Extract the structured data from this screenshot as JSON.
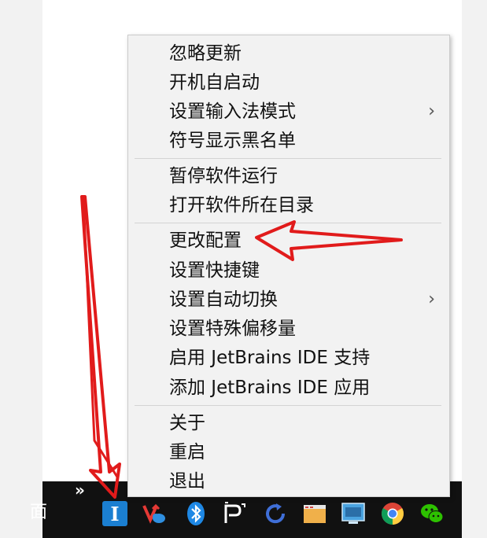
{
  "menu": {
    "groups": [
      {
        "items": [
          {
            "label": "忽略更新",
            "submenu": false
          },
          {
            "label": "开机自启动",
            "submenu": false
          },
          {
            "label": "设置输入法模式",
            "submenu": true
          },
          {
            "label": "符号显示黑名单",
            "submenu": false
          }
        ]
      },
      {
        "items": [
          {
            "label": "暂停软件运行",
            "submenu": false
          },
          {
            "label": "打开软件所在目录",
            "submenu": false
          }
        ]
      },
      {
        "items": [
          {
            "label": "更改配置",
            "submenu": false
          },
          {
            "label": "设置快捷键",
            "submenu": false
          },
          {
            "label": "设置自动切换",
            "submenu": true
          },
          {
            "label": "设置特殊偏移量",
            "submenu": false
          },
          {
            "label": "启用 JetBrains IDE 支持",
            "submenu": false
          },
          {
            "label": "添加 JetBrains IDE 应用",
            "submenu": false
          }
        ]
      },
      {
        "items": [
          {
            "label": "关于",
            "submenu": false
          },
          {
            "label": "重启",
            "submenu": false
          },
          {
            "label": "退出",
            "submenu": false
          }
        ]
      }
    ],
    "submenu_glyph": "›"
  },
  "taskbar": {
    "desktop_label": "面",
    "overflow_glyph": "»",
    "tray_icons": [
      {
        "name": "ime-icon",
        "glyph": "I",
        "color": "#1b7fd1"
      },
      {
        "name": "vlc-cloud-icon",
        "color": "#e53935"
      },
      {
        "name": "bluetooth-icon",
        "color": "#1e88e5"
      },
      {
        "name": "p-app-icon",
        "glyph": "P"
      },
      {
        "name": "refresh-icon",
        "color": "#3f6fd8"
      },
      {
        "name": "folder-icon",
        "color": "#f0b04a"
      },
      {
        "name": "monitor-icon",
        "color": "#4aa3df"
      },
      {
        "name": "chrome-icon"
      },
      {
        "name": "wechat-icon",
        "color": "#2dc100"
      }
    ]
  },
  "annotation": {
    "arrow_color": "#e11b1b"
  }
}
